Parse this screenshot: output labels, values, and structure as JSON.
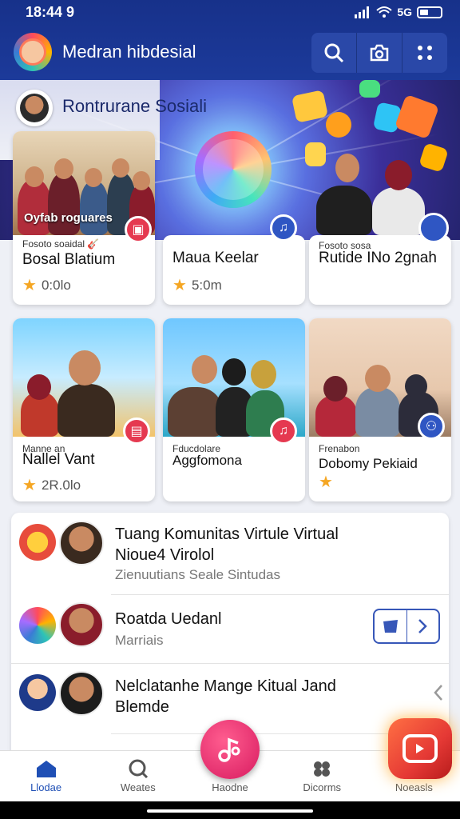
{
  "status": {
    "time": "18:44 9",
    "network": "5G"
  },
  "header": {
    "title": "Medran hibdesial"
  },
  "hero": {
    "title": "Rontrurane Sosiali"
  },
  "cards": [
    {
      "overlay": "Oyfab roguares",
      "small": "Fosoto soaidal 🎸",
      "name": "Bosal Blatium",
      "rating": "0:0lo"
    },
    {
      "small": "",
      "name": "Maua Keelar",
      "rating": "5:0m"
    },
    {
      "small": "Fosoto sosa",
      "name": "Rutide INo 2gnah",
      "rating": ""
    },
    {
      "small": "Manne an",
      "name": "Nallel Vant",
      "rating": "2R.0lo"
    },
    {
      "small": "Fducdolare",
      "name": "Aggfomona",
      "rating": ""
    },
    {
      "small": "Frenabon",
      "name": "Dobomy Pekiaid",
      "rating": ""
    }
  ],
  "list": [
    {
      "title": "Tuang Komunitas Virtule Virtual",
      "title2": "Nioue4 Virolol",
      "sub": "Zienuutians Seale Sintudas"
    },
    {
      "title": "Roatda Uedanl",
      "sub": "Marriais"
    },
    {
      "title": "Nelclatanhe Mange Kitual Jand",
      "title2": "Blemde"
    }
  ],
  "nav": [
    {
      "label": "Llodae"
    },
    {
      "label": "Weates"
    },
    {
      "label": "Haodne"
    },
    {
      "label": "Dicorms"
    },
    {
      "label": "Noeasls"
    }
  ],
  "colors": {
    "primary": "#1c3a9a",
    "accent": "#e91e63"
  }
}
